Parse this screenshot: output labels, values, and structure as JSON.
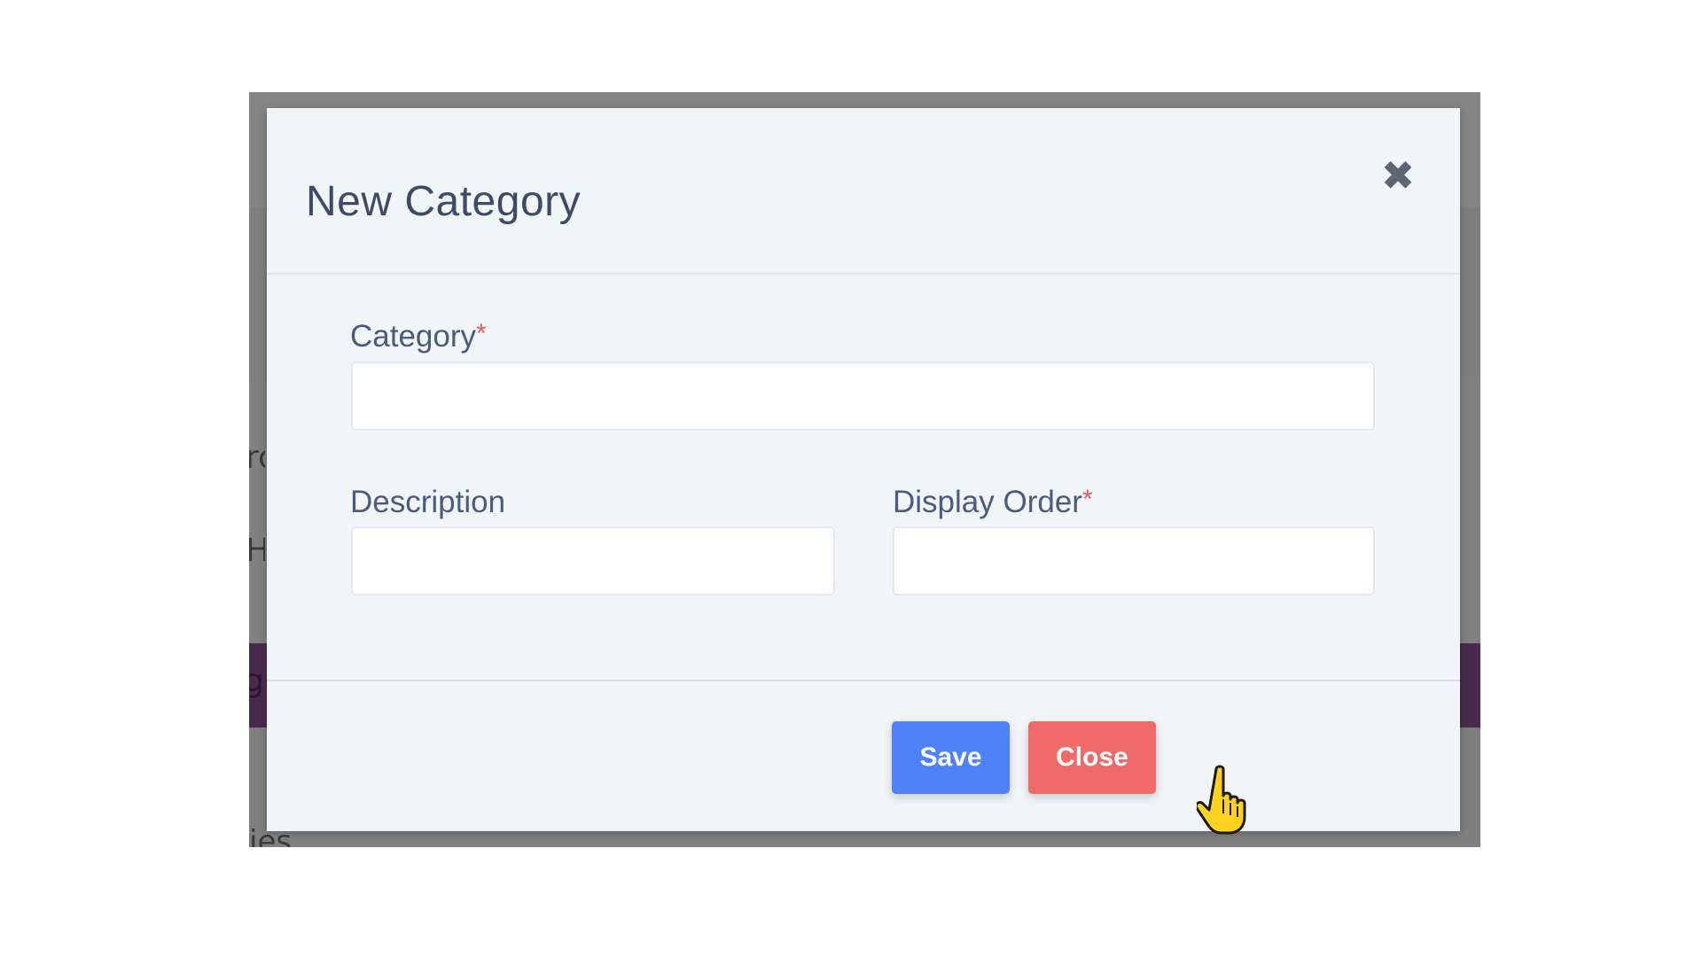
{
  "background": {
    "fragments": [
      "rc",
      "H",
      "gi",
      "ies"
    ]
  },
  "modal": {
    "title": "New Category",
    "close_icon": "close-icon",
    "fields": {
      "category": {
        "label": "Category",
        "required_mark": "*",
        "value": "",
        "placeholder": ""
      },
      "description": {
        "label": "Description",
        "value": "",
        "placeholder": ""
      },
      "display_order": {
        "label": "Display Order",
        "required_mark": "*",
        "value": "",
        "placeholder": ""
      }
    },
    "footer": {
      "save_label": "Save",
      "close_label": "Close"
    }
  },
  "colors": {
    "primary": "#4f82f7",
    "danger": "#f06a6a",
    "required": "#ee5a5a",
    "label": "#4c5a7d",
    "title": "#3f4b66"
  },
  "cursor": {
    "icon": "hand-pointer-icon"
  }
}
